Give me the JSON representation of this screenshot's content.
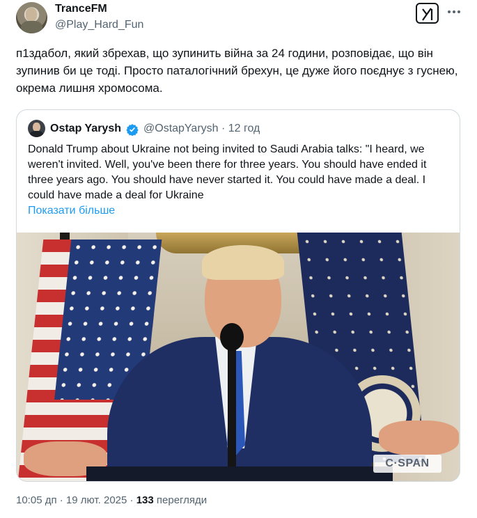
{
  "author": {
    "name": "TranceFM",
    "handle": "@Play_Hard_Fun"
  },
  "tweet_text": "п1здабол, який збрехав, що зупинить війна за 24 години, розповідає, що він зупинив би це тоді. Просто паталогічний брехун, це дуже його поєднує з гуснею, окрема лишня хромосома.",
  "quoted": {
    "name": "Ostap Yarysh",
    "handle_time": "@OstapYarysh · 12 год",
    "text": "Donald Trump about Ukraine not being invited to Saudi Arabia talks: \"I heard, we weren't invited. Well, you've been there for three years. You should have ended it three years ago. You should have never started it. You could have made a deal. I could have made a deal for Ukraine",
    "show_more": "Показати більше",
    "media_watermark": "C·SPAN"
  },
  "meta": {
    "timestamp": "10:05 дп · 19 лют. 2025 ·",
    "views_count": "133",
    "views_label": "перегляди"
  },
  "colors": {
    "link": "#1d9bf0",
    "secondary_text": "#536471",
    "verified": "#1d9bf0"
  },
  "icons": [
    "grok-icon",
    "more-icon",
    "verified-badge-icon"
  ]
}
